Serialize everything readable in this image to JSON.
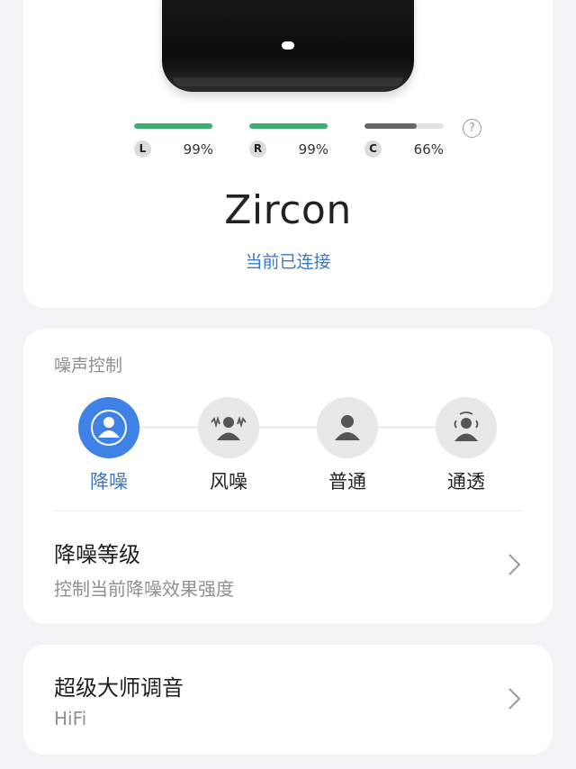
{
  "battery": {
    "left": {
      "label": "L",
      "percent_text": "99%",
      "level": 0.99,
      "color": "#3fae73"
    },
    "right": {
      "label": "R",
      "percent_text": "99%",
      "level": 0.99,
      "color": "#3fae73"
    },
    "case": {
      "label": "C",
      "percent_text": "66%",
      "level": 0.66,
      "color": "#666666"
    }
  },
  "help_icon": "?",
  "device": {
    "name": "Zircon",
    "status": "当前已连接"
  },
  "noise_control": {
    "title": "噪声控制",
    "modes": [
      {
        "label": "降噪",
        "icon": "noise-cancel-icon",
        "active": true
      },
      {
        "label": "风噪",
        "icon": "wind-noise-icon",
        "active": false
      },
      {
        "label": "普通",
        "icon": "normal-icon",
        "active": false
      },
      {
        "label": "通透",
        "icon": "transparency-icon",
        "active": false
      }
    ],
    "level_row": {
      "title": "降噪等级",
      "subtitle": "控制当前降噪效果强度"
    }
  },
  "hifi_row": {
    "title": "超级大师调音",
    "subtitle": "HiFi"
  },
  "colors": {
    "accent": "#3e82e8",
    "link": "#3a78c4",
    "battery_green": "#3fae73"
  }
}
